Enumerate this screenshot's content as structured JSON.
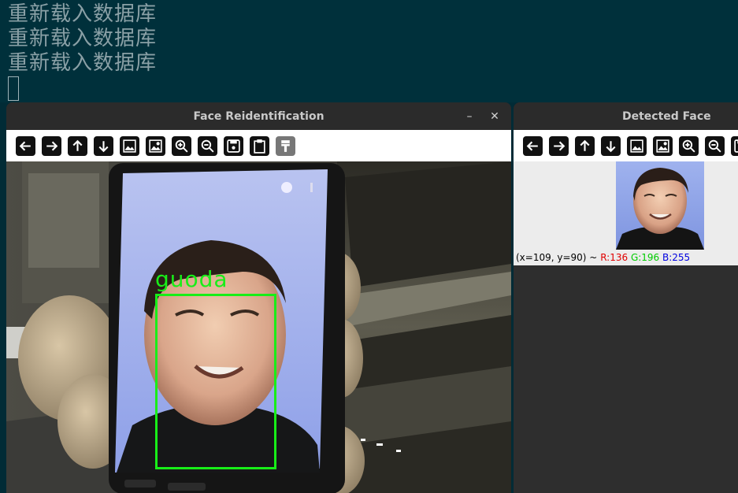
{
  "terminal": {
    "lines": [
      "重新载入数据库",
      "重新载入数据库",
      "重新载入数据库"
    ]
  },
  "main_window": {
    "title": "Face Reidentification",
    "minimize": "–",
    "close": "✕",
    "detection_label": "guoda",
    "toolbar": [
      "arrow-left-icon",
      "arrow-right-icon",
      "arrow-up-icon",
      "arrow-down-icon",
      "image-icon",
      "image-person-icon",
      "zoom-in-icon",
      "zoom-out-icon",
      "save-icon",
      "clipboard-icon",
      "brush-icon"
    ]
  },
  "face_window": {
    "title": "Detected Face",
    "status_coords": "(x=109, y=90) ~",
    "status_r": "R:136",
    "status_g": "G:196",
    "status_b": "B:255",
    "toolbar": [
      "arrow-left-icon",
      "arrow-right-icon",
      "arrow-up-icon",
      "arrow-down-icon",
      "image-icon",
      "image-person-icon",
      "zoom-in-icon",
      "zoom-out-icon",
      "save-icon"
    ]
  },
  "colors": {
    "terminal_bg": "#00303b",
    "detection_green": "#18ee18",
    "titlebar": "#2b2b2b"
  }
}
